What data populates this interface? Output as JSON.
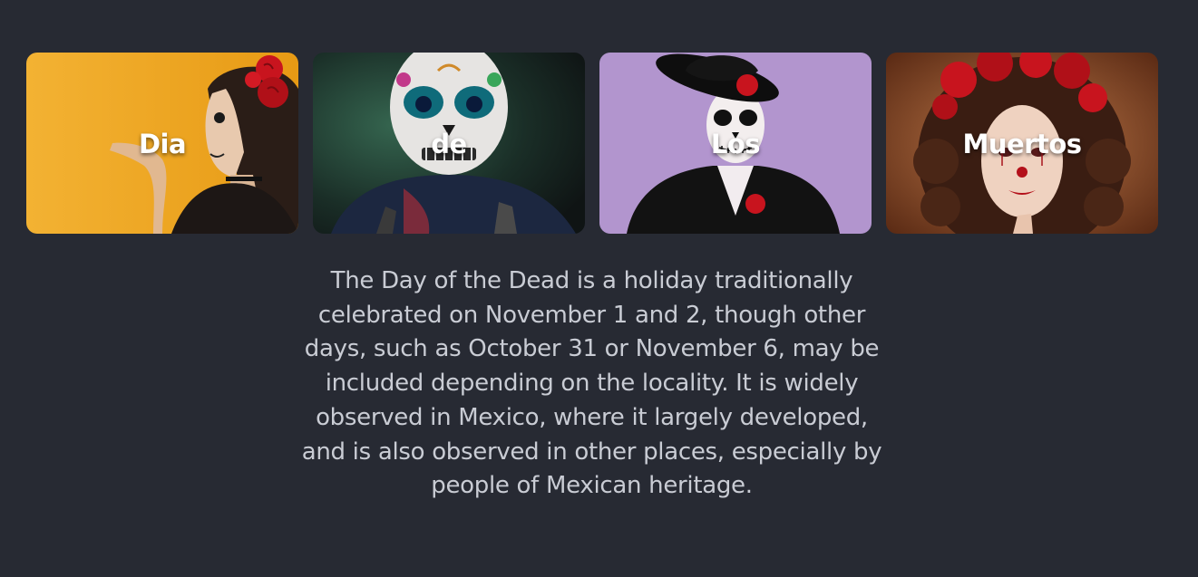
{
  "cards": [
    {
      "label": "Dia",
      "photo": "woman-catrina-makeup-blowing-kiss",
      "background": "#f0a81e"
    },
    {
      "label": "de",
      "photo": "sugar-skull-mask-person",
      "background": "#1f3a30"
    },
    {
      "label": "Los",
      "photo": "man-skull-makeup-black-hat",
      "background": "#b79ad2"
    },
    {
      "label": "Muertos",
      "photo": "woman-clown-makeup-red-roses",
      "background": "#9b5a34"
    }
  ],
  "description": "The Day of the Dead is a holiday traditionally celebrated on November 1 and 2, though other days, such as October 31 or November 6, may be included depending on the locality. It is widely observed in Mexico, where it largely developed, and is also observed in other places, especially by people of Mexican heritage.",
  "colors": {
    "page_background": "#272a33",
    "description_text": "#c9ccd4",
    "card_label": "#ffffff",
    "rose": "#c8141e"
  }
}
